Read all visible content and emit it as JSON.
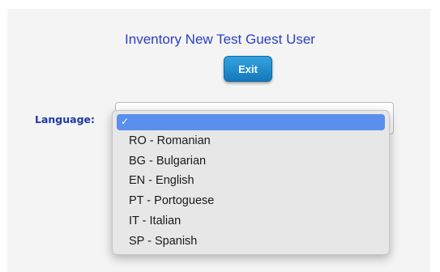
{
  "header": {
    "title": "Inventory New Test Guest User",
    "exit_label": "Exit"
  },
  "form": {
    "language_label": "Language:"
  },
  "language_dropdown": {
    "selected_mark": "✓",
    "options": [
      {
        "label": "RO - Romanian"
      },
      {
        "label": "BG - Bulgarian"
      },
      {
        "label": "EN - English"
      },
      {
        "label": "PT - Portoguese"
      },
      {
        "label": "IT - Italian"
      },
      {
        "label": "SP - Spanish"
      }
    ]
  },
  "colors": {
    "title": "#2a3fc4",
    "label": "#1c3aa8",
    "button": "#1e8bd0",
    "highlight": "#5b8fee"
  }
}
